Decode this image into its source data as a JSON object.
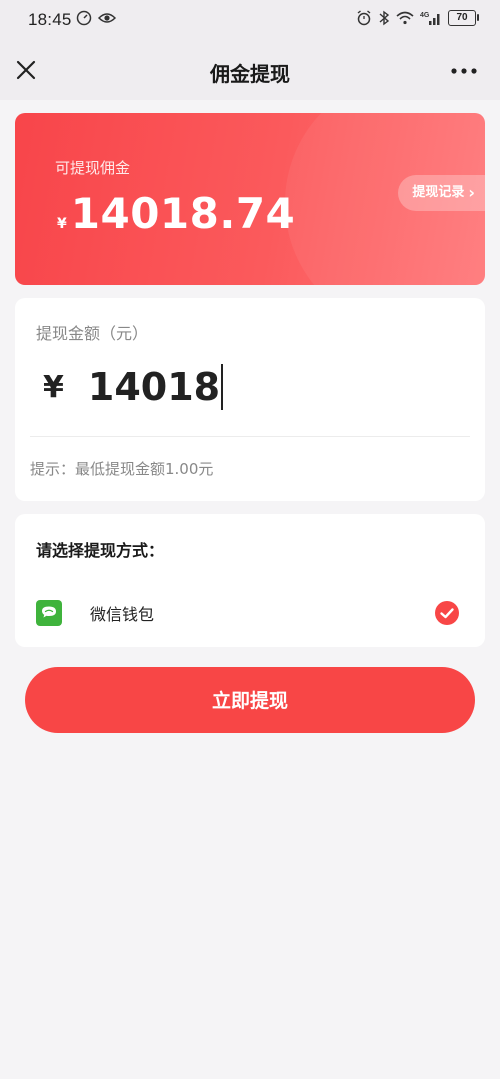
{
  "status_bar": {
    "time": "18:45",
    "battery": "70"
  },
  "nav": {
    "title": "佣金提现"
  },
  "balance": {
    "label": "可提现佣金",
    "currency": "¥",
    "value": "14018.74",
    "record_label": "提现记录",
    "record_arrow": "›"
  },
  "amount": {
    "label": "提现金额（元）",
    "currency": "¥",
    "value": "14018",
    "hint": "提示：最低提现金额1.00元"
  },
  "method": {
    "title": "请选择提现方式：",
    "options": [
      {
        "name": "微信钱包",
        "selected": true
      }
    ]
  },
  "submit": {
    "label": "立即提现"
  },
  "colors": {
    "accent": "#f84646",
    "wechat": "#3fb33c"
  }
}
